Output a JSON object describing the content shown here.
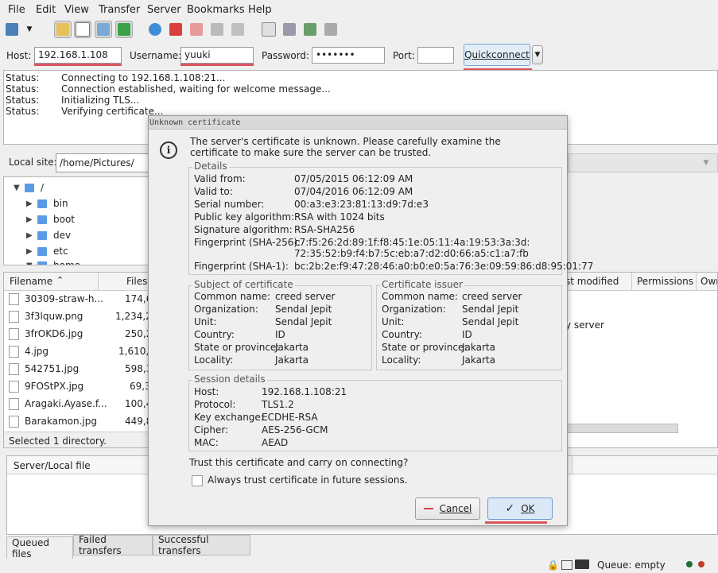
{
  "menu": [
    "File",
    "Edit",
    "View",
    "Transfer",
    "Server",
    "Bookmarks",
    "Help"
  ],
  "quickconnect": {
    "host_label": "Host:",
    "host_value": "192.168.1.108",
    "username_label": "Username:",
    "username_value": "yuuki",
    "password_label": "Password:",
    "password_value": "•••••••",
    "port_label": "Port:",
    "port_value": "",
    "button_label": "Quickconnect"
  },
  "log": [
    {
      "k": "Status:",
      "v": "Connecting to 192.168.1.108:21..."
    },
    {
      "k": "Status:",
      "v": "Connection established, waiting for welcome message..."
    },
    {
      "k": "Status:",
      "v": "Initializing TLS..."
    },
    {
      "k": "Status:",
      "v": "Verifying certificate..."
    }
  ],
  "local": {
    "site_label": "Local site:",
    "site_value": "/home/Pictures/",
    "tree": [
      "/",
      "bin",
      "boot",
      "dev",
      "etc",
      "home"
    ],
    "columns": {
      "filename": "Filename",
      "filesize": "Files"
    },
    "files": [
      {
        "name": "30309-straw-h...",
        "size": "174,6"
      },
      {
        "name": "3f3lquw.png",
        "size": "1,234,2"
      },
      {
        "name": "3frOKD6.jpg",
        "size": "250,2"
      },
      {
        "name": "4.jpg",
        "size": "1,610,1"
      },
      {
        "name": "542751.jpg",
        "size": "598,3"
      },
      {
        "name": "9FOStPX.jpg",
        "size": "69,3"
      },
      {
        "name": "Aragaki.Ayase.f...",
        "size": "100,4"
      },
      {
        "name": "Barakamon.jpg",
        "size": "449,8"
      }
    ],
    "status": "Selected 1 directory."
  },
  "remote": {
    "columns": {
      "modified": "st modified",
      "permissions": "Permissions",
      "owner": "Owr"
    },
    "note": "y server"
  },
  "queue": {
    "column": "Server/Local file"
  },
  "tabs": [
    "Queued files",
    "Failed transfers",
    "Successful transfers"
  ],
  "statusbar": {
    "queue": "Queue: empty"
  },
  "dialog": {
    "title": "Unknown certificate",
    "message": "The server's certificate is unknown. Please carefully examine the certificate to make sure the server can be trusted.",
    "details": {
      "title": "Details",
      "rows": [
        {
          "k": "Valid from:",
          "v": "07/05/2015 06:12:09 AM"
        },
        {
          "k": "Valid to:",
          "v": "07/04/2016 06:12:09 AM"
        },
        {
          "k": "Serial number:",
          "v": "00:a3:e3:23:81:13:d9:7d:e3"
        },
        {
          "k": "Public key algorithm:",
          "v": "RSA with 1024 bits"
        },
        {
          "k": "Signature algorithm:",
          "v": "RSA-SHA256"
        },
        {
          "k": "Fingerprint (SHA-256):",
          "v": "c7:f5:26:2d:89:1f:f8:45:1e:05:11:4a:19:53:3a:3d:"
        },
        {
          "k": "",
          "v": "72:35:52:b9:f4:b7:5c:eb:a7:d2:d0:66:a5:c1:a7:fb"
        },
        {
          "k": "Fingerprint (SHA-1):",
          "v": "bc:2b:2e:f9:47:28:46:a0:b0:e0:5a:76:3e:09:59:86:d8:95:01:77"
        }
      ]
    },
    "subject": {
      "title": "Subject of certificate",
      "rows": [
        {
          "k": "Common name:",
          "v": "creed server"
        },
        {
          "k": "Organization:",
          "v": "Sendal Jepit"
        },
        {
          "k": "Unit:",
          "v": "Sendal Jepit"
        },
        {
          "k": "Country:",
          "v": "ID"
        },
        {
          "k": "State or province:",
          "v": "Jakarta"
        },
        {
          "k": "Locality:",
          "v": "Jakarta"
        }
      ]
    },
    "issuer": {
      "title": "Certificate issuer",
      "rows": [
        {
          "k": "Common name:",
          "v": "creed server"
        },
        {
          "k": "Organization:",
          "v": "Sendal Jepit"
        },
        {
          "k": "Unit:",
          "v": "Sendal Jepit"
        },
        {
          "k": "Country:",
          "v": "ID"
        },
        {
          "k": "State or province:",
          "v": "Jakarta"
        },
        {
          "k": "Locality:",
          "v": "Jakarta"
        }
      ]
    },
    "session": {
      "title": "Session details",
      "rows": [
        {
          "k": "Host:",
          "v": "192.168.1.108:21"
        },
        {
          "k": "Protocol:",
          "v": "TLS1.2"
        },
        {
          "k": "Key exchange:",
          "v": "ECDHE-RSA"
        },
        {
          "k": "Cipher:",
          "v": "AES-256-GCM"
        },
        {
          "k": "MAC:",
          "v": "AEAD"
        }
      ]
    },
    "trust_question": "Trust this certificate and carry on connecting?",
    "always_trust_label": "Always trust certificate in future sessions.",
    "cancel_label": "Cancel",
    "ok_label": "OK"
  }
}
